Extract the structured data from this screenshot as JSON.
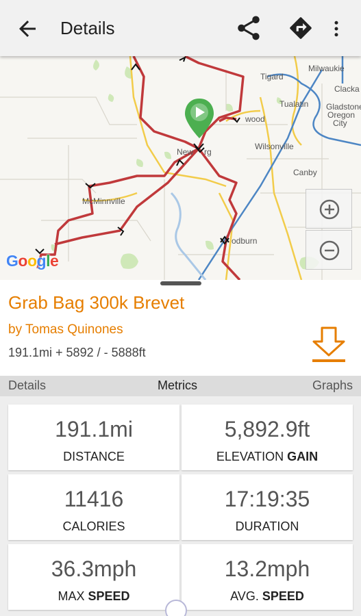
{
  "appbar": {
    "title": "Details",
    "back_icon": "arrow-back-icon",
    "share_icon": "share-icon",
    "navigate_icon": "directions-icon",
    "more_icon": "more-vert-icon"
  },
  "map": {
    "labels": {
      "milwaukie": "Milwaukie",
      "tigard": "Tigard",
      "clacka": "Clacka",
      "tualatin": "Tualatin",
      "gladstone": "Gladstone",
      "oregon": "Oregon",
      "city": "City",
      "sherwood": "wood",
      "wilsonville": "Wilsonville",
      "newberg_a": "New",
      "newberg_b": "rg",
      "canby": "Canby",
      "mcminnville": "McMinnville",
      "woodburn": "odburn"
    },
    "google_logo": "Google",
    "zoom_in_icon": "plus-circle-icon",
    "zoom_out_icon": "minus-circle-icon",
    "route_color": "#c0393b",
    "highway_color": "#f0c030"
  },
  "route": {
    "title": "Grab Bag 300k Brevet",
    "author": "by Tomas Quinones",
    "stats": "191.1mi  + 5892 / - 5888ft",
    "accent": "#e67e00",
    "download_icon": "download-icon"
  },
  "tabs": {
    "details": "Details",
    "metrics": "Metrics",
    "graphs": "Graphs"
  },
  "metrics": {
    "distance": {
      "value": "191.1mi",
      "label": "DISTANCE",
      "label_bold": ""
    },
    "elevation": {
      "value": "5,892.9ft",
      "label": "ELEVATION ",
      "label_bold": "GAIN"
    },
    "calories": {
      "value": "11416",
      "label": "CALORIES",
      "label_bold": ""
    },
    "duration": {
      "value": "17:19:35",
      "label": "DURATION",
      "label_bold": ""
    },
    "max_speed": {
      "value": "36.3mph",
      "label": "MAX ",
      "label_bold": "SPEED"
    },
    "avg_speed": {
      "value": "13.2mph",
      "label": "AVG. ",
      "label_bold": "SPEED"
    }
  }
}
